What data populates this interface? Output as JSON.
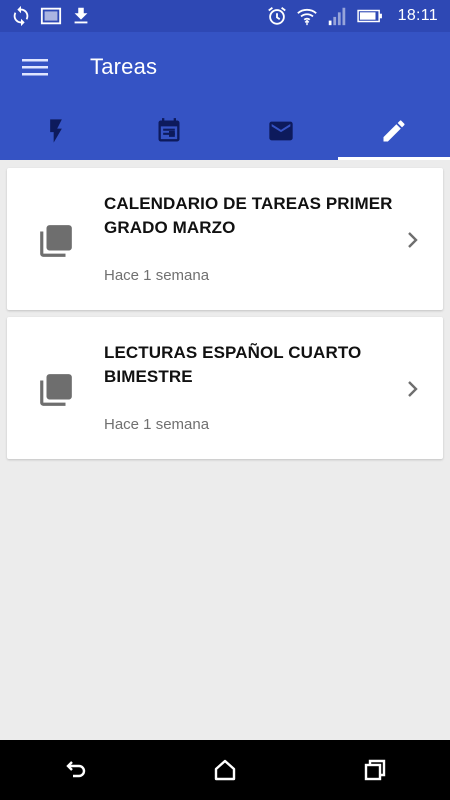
{
  "status_bar": {
    "time": "18:11",
    "icons": [
      "sync-icon",
      "image-icon",
      "download-icon",
      "alarm-icon",
      "wifi-icon",
      "signal-icon",
      "battery-icon"
    ]
  },
  "app_bar": {
    "title": "Tareas",
    "menu_icon": "hamburger-menu-icon"
  },
  "tabs": [
    {
      "icon": "flash-icon",
      "active": false
    },
    {
      "icon": "calendar-icon",
      "active": false
    },
    {
      "icon": "mail-icon",
      "active": false
    },
    {
      "icon": "edit-icon",
      "active": true
    }
  ],
  "items": [
    {
      "title": "CALENDARIO DE TAREAS PRIMER GRADO MARZO",
      "time": "Hace 1 semana",
      "icon": "library-books-icon"
    },
    {
      "title": "LECTURAS ESPAÑOL CUARTO BIMESTRE",
      "time": "Hace 1 semana",
      "icon": "library-books-icon"
    }
  ],
  "nav_bar": {
    "icons": [
      "back-icon",
      "home-icon",
      "recents-icon"
    ]
  },
  "colors": {
    "status_bar": "#2e48b4",
    "app_bar": "#3553c4",
    "tab_icon_inactive": "#0d1a5c",
    "tab_icon_active": "#ffffff",
    "background": "#ececec"
  }
}
